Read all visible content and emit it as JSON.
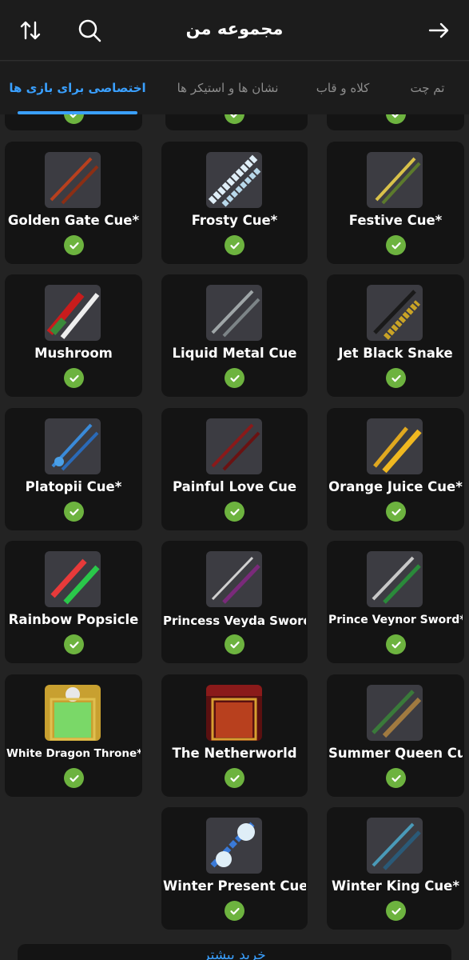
{
  "header": {
    "title": "مجموعه من",
    "sort_icon": "sort-arrows-icon",
    "search_icon": "search-icon",
    "back_icon": "arrow-right-icon"
  },
  "tabs": [
    {
      "label": "اختصاصی برای بازی ها",
      "active": true
    },
    {
      "label": "نشان ها و استیکر ها",
      "active": false
    },
    {
      "label": "کلاه و قاب",
      "active": false
    },
    {
      "label": "تم چت",
      "active": false
    }
  ],
  "items": [
    {
      "name": "Festive Cue*",
      "owned": true
    },
    {
      "name": "Frosty Cue*",
      "owned": true
    },
    {
      "name": "Golden Gate Cue*",
      "owned": true
    },
    {
      "name": "Jet Black Snake",
      "owned": true
    },
    {
      "name": "Liquid Metal Cue",
      "owned": true
    },
    {
      "name": "Mushroom",
      "owned": true
    },
    {
      "name": "Orange Juice Cue*",
      "owned": true
    },
    {
      "name": "Painful Love Cue",
      "owned": true
    },
    {
      "name": "Platopii Cue*",
      "owned": true
    },
    {
      "name": "Prince Veynor Sword*",
      "owned": true
    },
    {
      "name": "Princess Veyda Sword",
      "owned": true
    },
    {
      "name": "Rainbow Popsicle",
      "owned": true
    },
    {
      "name": "Summer Queen Cue*",
      "owned": true
    },
    {
      "name": "The Netherworld",
      "owned": true
    },
    {
      "name": "White Dragon Throne*",
      "owned": true
    },
    {
      "name": "Winter King Cue*",
      "owned": true
    },
    {
      "name": "Winter Present Cue*",
      "owned": true
    }
  ],
  "bottom_button": {
    "label": "خرید بیشتر"
  },
  "colors": {
    "accent": "#3aa0ff",
    "check": "#6db33f",
    "card": "#141414",
    "background": "#232323"
  }
}
